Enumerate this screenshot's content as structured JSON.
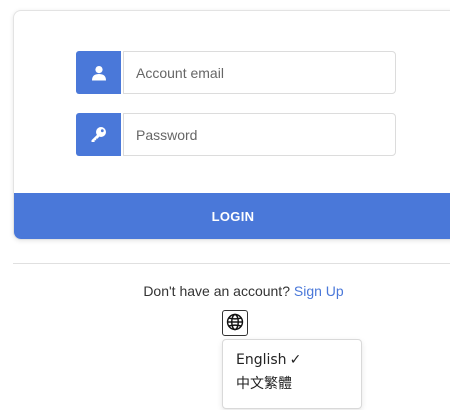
{
  "login_form": {
    "email_placeholder": "Account email",
    "password_placeholder": "Password",
    "login_label": "LOGIN",
    "user_icon": "user-icon",
    "key_icon": "key-icon"
  },
  "signup": {
    "prompt": "Don't have an account?",
    "link_label": "Sign Up"
  },
  "language": {
    "icon": "globe-icon",
    "options": [
      {
        "label": "English",
        "selected_mark": "✓"
      },
      {
        "label": "中文繁體"
      }
    ]
  },
  "colors": {
    "accent": "#4a78d9",
    "text": "#333333",
    "border": "#dcdcdc"
  }
}
